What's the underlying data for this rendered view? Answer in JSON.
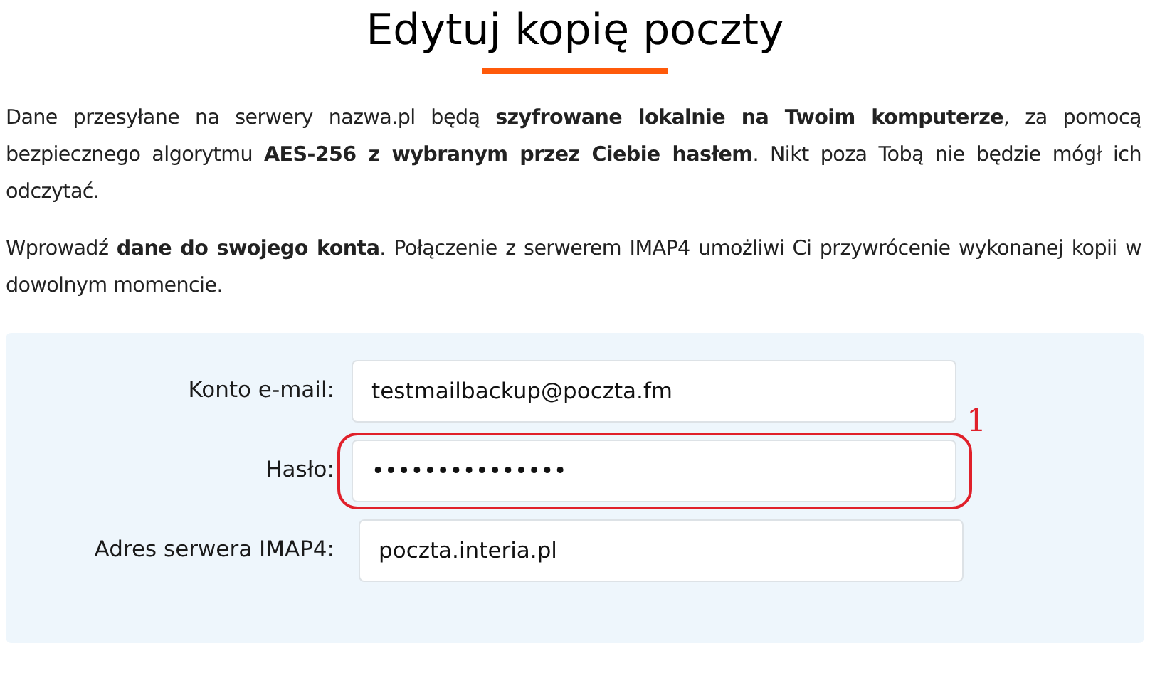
{
  "title": "Edytuj kopię poczty",
  "paragraphs": [
    "Dane przesyłane na serwery nazwa.pl będą **szyfrowane lokalnie na Twoim komputerze**, za pomocą bezpiecznego algorytmu **AES-256 z wybranym przez Ciebie hasłem**. Nikt poza Tobą nie będzie mógł ich odczytać.",
    "Wprowadź **dane do swojego konta**. Połączenie z serwerem IMAP4 umożliwi Ci przywrócenie wykonanej kopii w dowolnym momencie."
  ],
  "form": [
    {
      "label": "Konto e-mail:",
      "value": "testmailbackup@poczta.fm",
      "highlighted": false
    },
    {
      "label": "Hasło:",
      "value": "•••••••••••••••",
      "highlighted": true,
      "annotation": "1"
    },
    {
      "label": "Adres serwera IMAP4:",
      "value": "poczta.interia.pl",
      "highlighted": false
    }
  ]
}
